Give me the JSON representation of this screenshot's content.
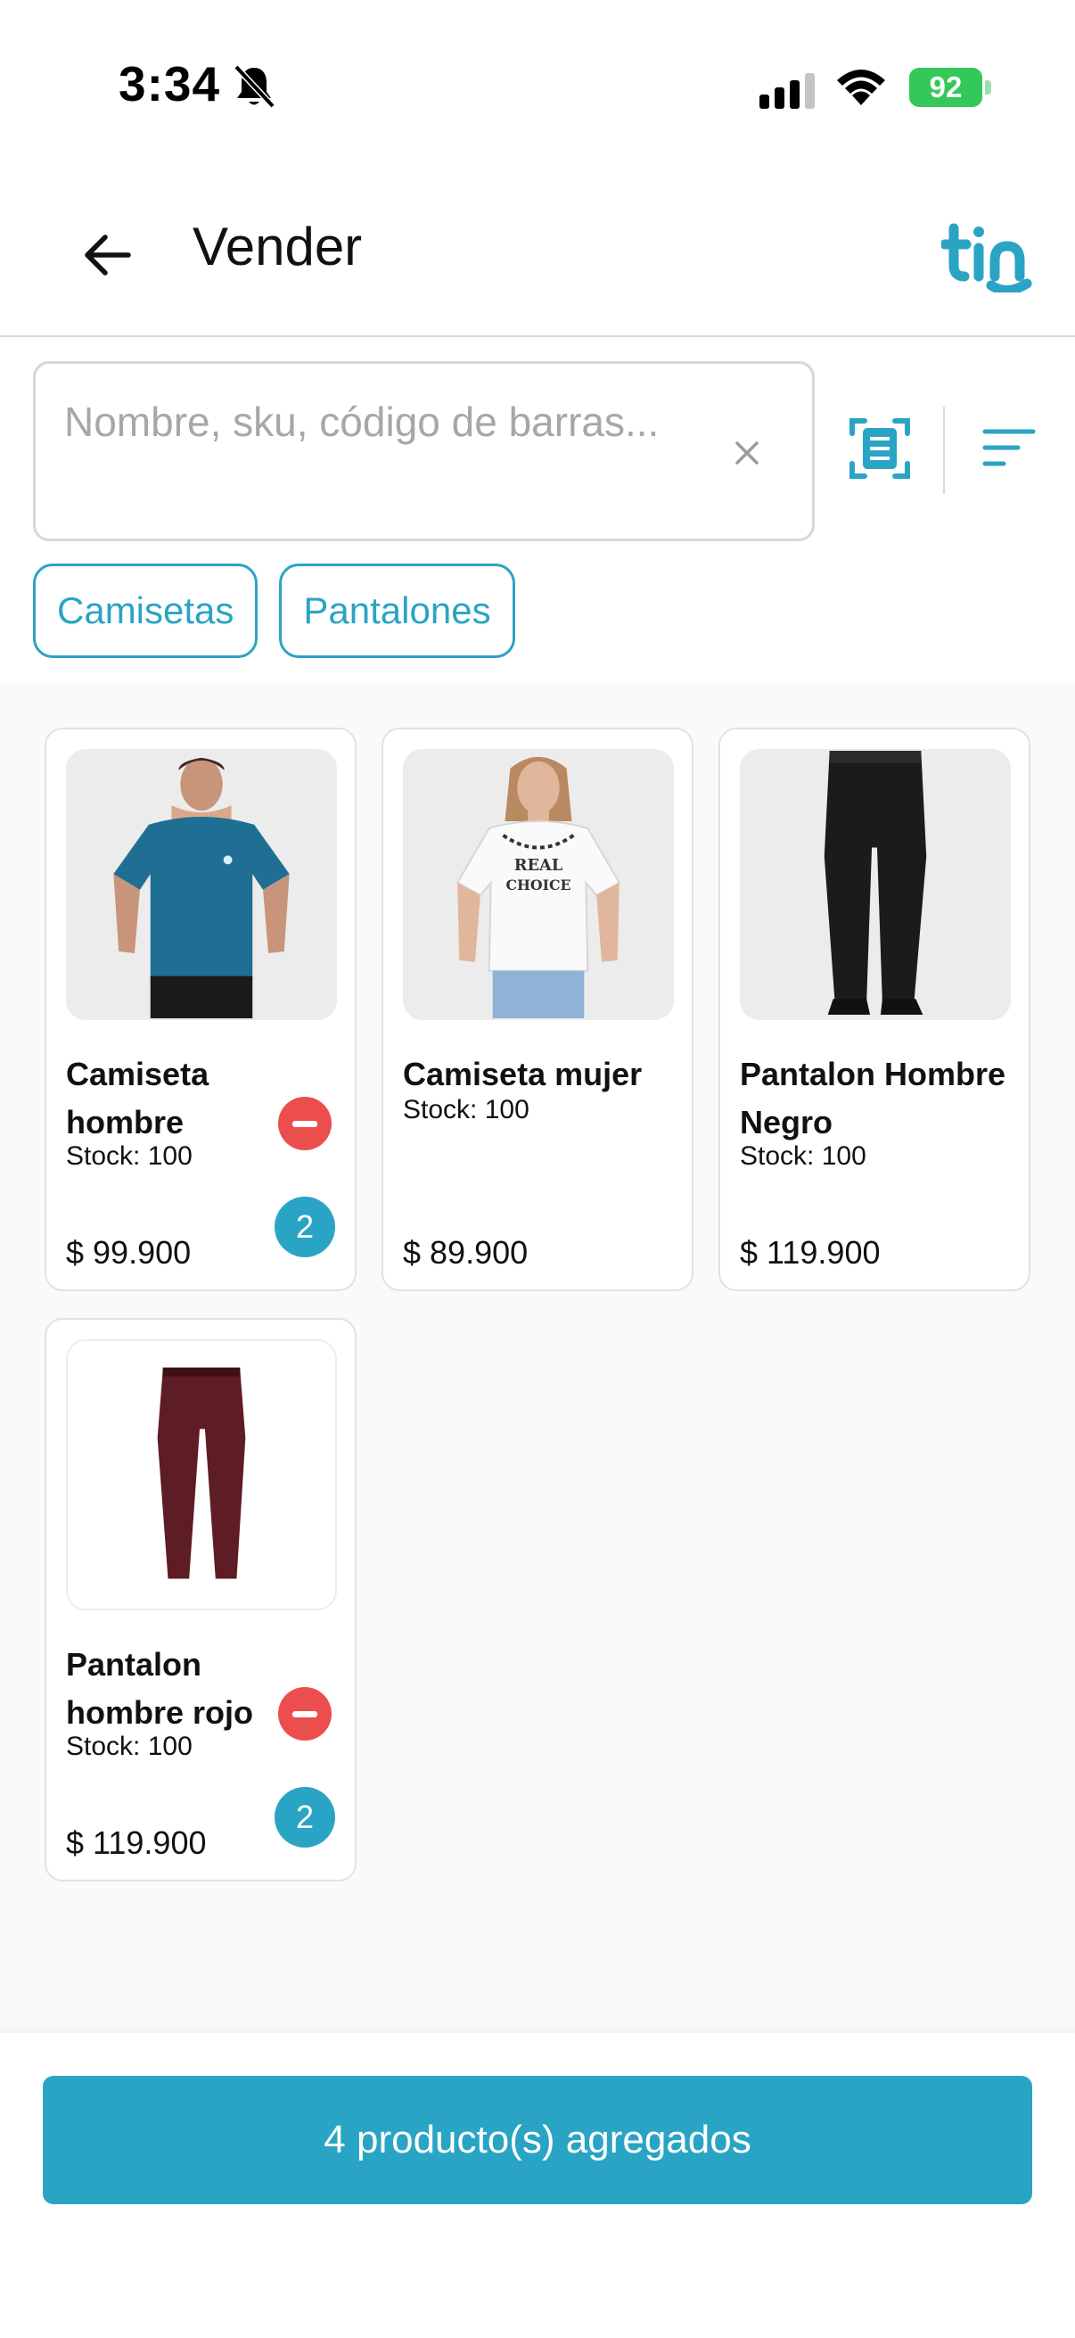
{
  "status_bar": {
    "time": "3:34",
    "battery_level": "92",
    "icons": [
      "bell-slash-icon",
      "cellular-signal-icon",
      "wifi-icon",
      "battery-charging-icon"
    ]
  },
  "header": {
    "title": "Vender",
    "back_icon": "arrow-left-icon",
    "brand": "tin"
  },
  "search": {
    "placeholder": "Nombre, sku, código de barras...",
    "value": "",
    "clear_icon": "close-icon",
    "scan_icon": "barcode-scan-icon",
    "filter_icon": "sort-filter-icon"
  },
  "categories": [
    {
      "label": "Camisetas"
    },
    {
      "label": "Pantalones"
    }
  ],
  "products": [
    {
      "name": "Camiseta hombre",
      "stock": "Stock: 100",
      "price": "$ 99.900",
      "quantity": "2"
    },
    {
      "name": "Camiseta mujer",
      "stock": "Stock: 100",
      "price": "$ 89.900"
    },
    {
      "name": "Pantalon Hombre Negro",
      "stock": "Stock: 100",
      "price": "$ 119.900"
    },
    {
      "name": "Pantalon hombre rojo",
      "stock": "Stock: 100",
      "price": "$ 119.900",
      "quantity": "2"
    }
  ],
  "footer": {
    "button_label": "4 producto(s) agregados"
  },
  "colors": {
    "accent": "#2aa4c4",
    "danger": "#ec4e4e",
    "battery": "#34c759",
    "text": "#111111"
  }
}
